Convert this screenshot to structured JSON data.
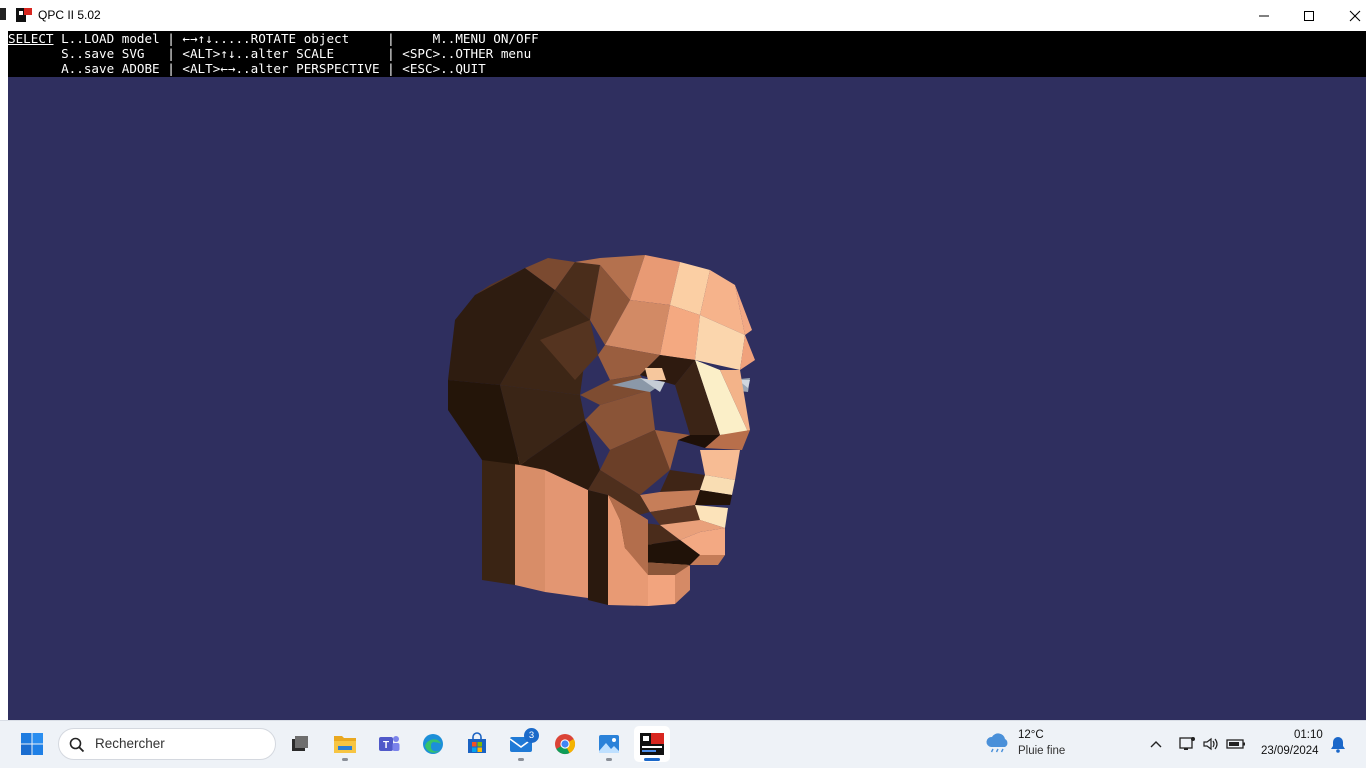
{
  "window": {
    "title": "QPC II 5.02"
  },
  "menu": {
    "select_label": "SELECT",
    "line1_rest": " L..LOAD model | ←→↑↓.....ROTATE object     |     M..MENU ON/OFF",
    "line2": "       S..save SVG   | <ALT>↑↓..alter SCALE       | <SPC>..OTHER menu",
    "line3": "       A..save ADOBE | <ALT>←→..alter PERSPECTIVE | <ESC>..QUIT"
  },
  "colors": {
    "screen_bg": "#2f2f5f",
    "menu_bg": "#000000",
    "skin_light": "#f0a27c",
    "skin_dark": "#2b1a10",
    "accent": "#1a67c9"
  },
  "taskbar": {
    "search_placeholder": "Rechercher",
    "mail_badge": "3",
    "weather_temp": "12°C",
    "weather_desc": "Pluie fine",
    "clock_time": "01:10",
    "clock_date": "23/09/2024",
    "icons": [
      "start-icon",
      "task-view-icon",
      "file-explorer-icon",
      "teams-icon",
      "edge-icon",
      "store-icon",
      "mail-icon",
      "chrome-icon",
      "photos-icon",
      "qpc-icon"
    ]
  }
}
